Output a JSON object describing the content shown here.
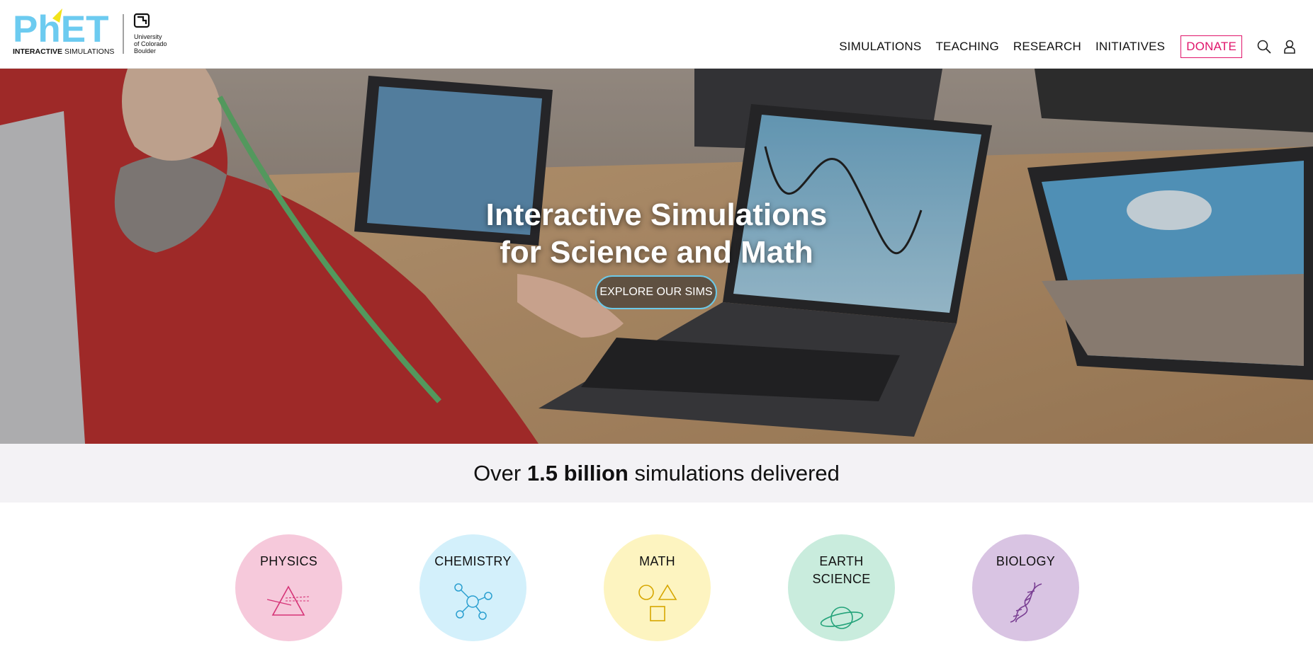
{
  "header": {
    "logo": {
      "wordmark": "PhET",
      "tagline_bold": "INTERACTIVE",
      "tagline_rest": "SIMULATIONS",
      "university_lines": [
        "University",
        "of Colorado",
        "Boulder"
      ]
    },
    "nav": [
      {
        "label": "SIMULATIONS"
      },
      {
        "label": "TEACHING"
      },
      {
        "label": "RESEARCH"
      },
      {
        "label": "INITIATIVES"
      }
    ],
    "donate_label": "DONATE",
    "icons": [
      "search-icon",
      "user-icon"
    ]
  },
  "hero": {
    "title_line1": "Interactive Simulations",
    "title_line2": "for Science and Math",
    "button_label": "EXPLORE OUR SIMS"
  },
  "stats": {
    "prefix": "Over ",
    "highlight": "1.5 billion",
    "suffix": " simulations delivered"
  },
  "subjects": [
    {
      "label": "PHYSICS",
      "color": "#f6c9db",
      "icon": "prism-icon"
    },
    {
      "label": "CHEMISTRY",
      "color": "#d3f0fb",
      "icon": "molecule-icon"
    },
    {
      "label": "MATH",
      "color": "#fdf4c0",
      "icon": "shapes-icon"
    },
    {
      "label": "EARTH SCIENCE",
      "label_line1": "EARTH",
      "label_line2": "SCIENCE",
      "color": "#c9ecdd",
      "icon": "planet-icon"
    },
    {
      "label": "BIOLOGY",
      "color": "#d9c4e3",
      "icon": "dna-icon"
    }
  ],
  "colors": {
    "accent_pink": "#e0156b",
    "logo_blue": "#6ccbf0",
    "logo_yellow": "#f2e31b",
    "hero_button_border": "#6cc9e8",
    "stats_band": "#f3f2f5"
  }
}
